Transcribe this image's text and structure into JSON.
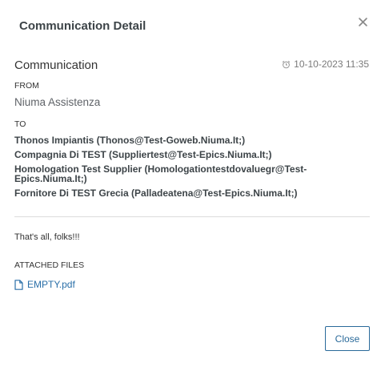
{
  "modal": {
    "title": "Communication Detail",
    "close_icon": "close-icon"
  },
  "communication": {
    "heading": "Communication",
    "date_icon": "alarm-clock-icon",
    "datetime": "10-10-2023 11:35"
  },
  "from": {
    "label": "FROM",
    "value": "Niuma Assistenza"
  },
  "to": {
    "label": "TO",
    "recipients": [
      "Thonos Impiantis (Thonos@Test-Goweb.Niuma.It;)",
      "Compagnia Di TEST (Suppliertest@Test-Epics.Niuma.It;)",
      "Homologation Test Supplier (Homologationtestdovaluegr@Test-Epics.Niuma.It;)",
      "Fornitore Di TEST Grecia (Palladeatena@Test-Epics.Niuma.It;)"
    ]
  },
  "message": "That's all, folks!!!",
  "attachments": {
    "label": "ATTACHED FILES",
    "file_icon": "document-icon",
    "files": [
      "EMPTY.pdf"
    ]
  },
  "footer": {
    "close_label": "Close"
  },
  "colors": {
    "link": "#2a6fa8",
    "button_border": "#2a6a9a",
    "divider": "#dcdcdc"
  }
}
